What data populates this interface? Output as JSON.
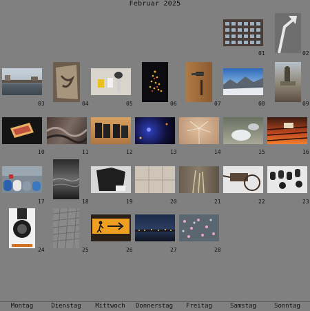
{
  "calendar": {
    "title": "Februar 2025",
    "weekdays": [
      "Montag",
      "Dienstag",
      "Mittwoch",
      "Donnerstag",
      "Freitag",
      "Samstag",
      "Sonntag"
    ],
    "days": [
      {
        "day": "01",
        "photo": "building-facade"
      },
      {
        "day": "02",
        "photo": "arrow-road-sign"
      },
      {
        "day": "03",
        "photo": "river-town"
      },
      {
        "day": "04",
        "photo": "spiral-staircase"
      },
      {
        "day": "05",
        "photo": "cup-and-brush"
      },
      {
        "day": "06",
        "photo": "christmas-tree-lights"
      },
      {
        "day": "07",
        "photo": "door-handle"
      },
      {
        "day": "08",
        "photo": "mountain-panorama"
      },
      {
        "day": "09",
        "photo": "fountain-statue"
      },
      {
        "day": "10",
        "photo": "glowing-card"
      },
      {
        "day": "11",
        "photo": "fabric-folds"
      },
      {
        "day": "12",
        "photo": "boots-on-floor"
      },
      {
        "day": "13",
        "photo": "night-lights"
      },
      {
        "day": "14",
        "photo": "dandelion"
      },
      {
        "day": "15",
        "photo": "frosted-leaves"
      },
      {
        "day": "16",
        "photo": "grill-fire"
      },
      {
        "day": "17",
        "photo": "colored-barrels"
      },
      {
        "day": "18",
        "photo": "dark-water"
      },
      {
        "day": "19",
        "photo": "black-jacket"
      },
      {
        "day": "20",
        "photo": "tiled-wall"
      },
      {
        "day": "21",
        "photo": "dry-grass"
      },
      {
        "day": "22",
        "photo": "old-cart"
      },
      {
        "day": "23",
        "photo": "car-keys"
      },
      {
        "day": "24",
        "photo": "wheel-rim"
      },
      {
        "day": "25",
        "photo": "cobblestone"
      },
      {
        "day": "26",
        "photo": "pedestrian-sign"
      },
      {
        "day": "27",
        "photo": "night-harbor"
      },
      {
        "day": "28",
        "photo": "petals-on-ground"
      }
    ]
  }
}
